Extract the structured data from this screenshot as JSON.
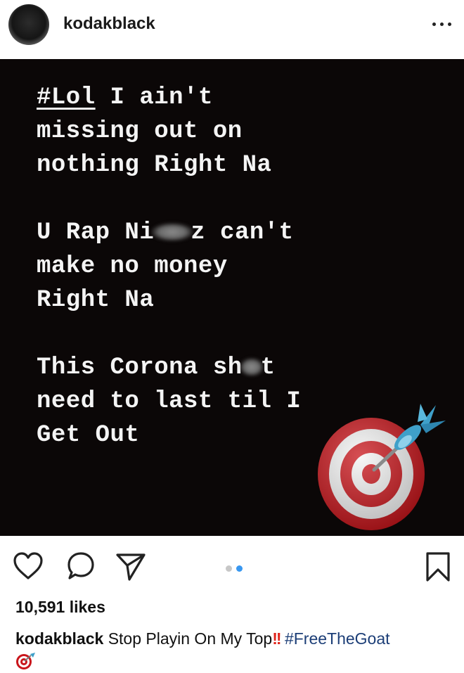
{
  "header": {
    "username": "kodakblack"
  },
  "post": {
    "lines": [
      {
        "tag": "#Lol",
        "text": " I ain't"
      },
      {
        "text": "missing out on"
      },
      {
        "text": "nothing Right Na"
      },
      {
        "pre": "U Rap Ni",
        "post": "z can't"
      },
      {
        "text": "make no money"
      },
      {
        "text": "Right Na"
      },
      {
        "pre": "This Corona sh",
        "post": "t"
      },
      {
        "text": "need to last til I"
      },
      {
        "text": "Get Out"
      }
    ],
    "colors": {
      "background": "#0b0707",
      "text": "#f4f4f4"
    },
    "sticker_icon": "direct-hit-target-icon"
  },
  "actions": {
    "like_icon": "heart-icon",
    "comment_icon": "comment-icon",
    "share_icon": "send-icon",
    "save_icon": "bookmark-icon",
    "carousel": {
      "total": 2,
      "active": 2,
      "active_color": "#3897f0",
      "inactive_color": "#c7c7c7"
    }
  },
  "likes": "10,591 likes",
  "caption": {
    "username": "kodakblack",
    "text": "Stop Playin On My Top",
    "exclamation": "!!",
    "hashtag": "#FreeTheGoat",
    "trailing_icon": "direct-hit-target-icon"
  }
}
